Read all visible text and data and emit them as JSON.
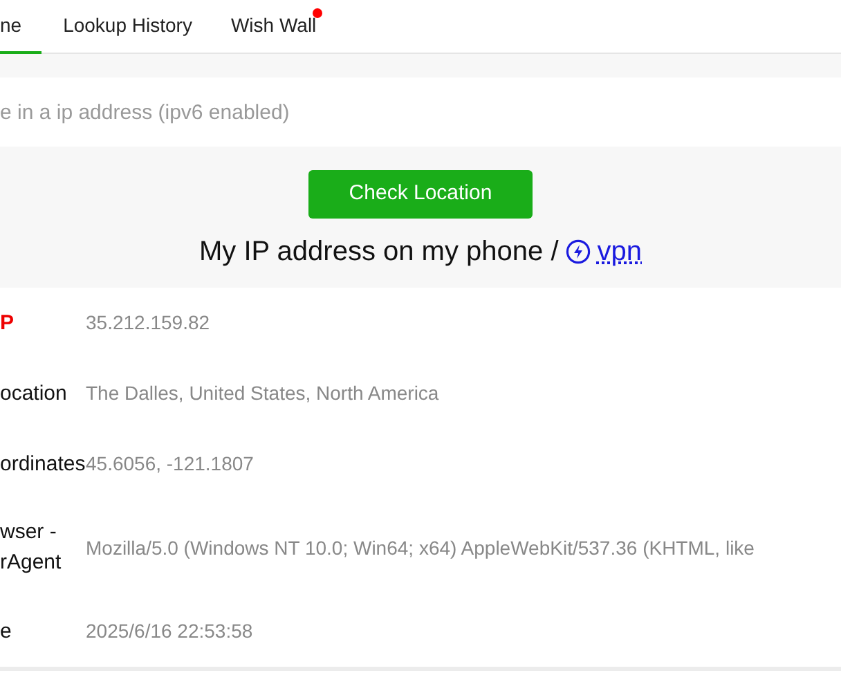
{
  "tabs": [
    {
      "label": "ne",
      "selected": true,
      "dot": false
    },
    {
      "label": "Lookup History",
      "selected": false,
      "dot": false
    },
    {
      "label": "Wish Wall",
      "selected": false,
      "dot": true
    }
  ],
  "search": {
    "placeholder": "e in a ip address (ipv6 enabled)"
  },
  "check_button": "Check Location",
  "heading": {
    "text": "My IP address on my phone /",
    "link": "vpn"
  },
  "details": [
    {
      "label": "P",
      "value": "35.212.159.82",
      "highlight": true
    },
    {
      "label": "ocation",
      "value": "The Dalles, United States, North America",
      "highlight": false
    },
    {
      "label": "ordinates",
      "value": "45.6056, -121.1807",
      "highlight": false
    },
    {
      "label": "wser -\nrAgent",
      "value": "Mozilla/5.0 (Windows NT 10.0; Win64; x64) AppleWebKit/537.36 (KHTML, like",
      "highlight": false
    },
    {
      "label": "e",
      "value": "2025/6/16 22:53:58",
      "highlight": false
    }
  ]
}
